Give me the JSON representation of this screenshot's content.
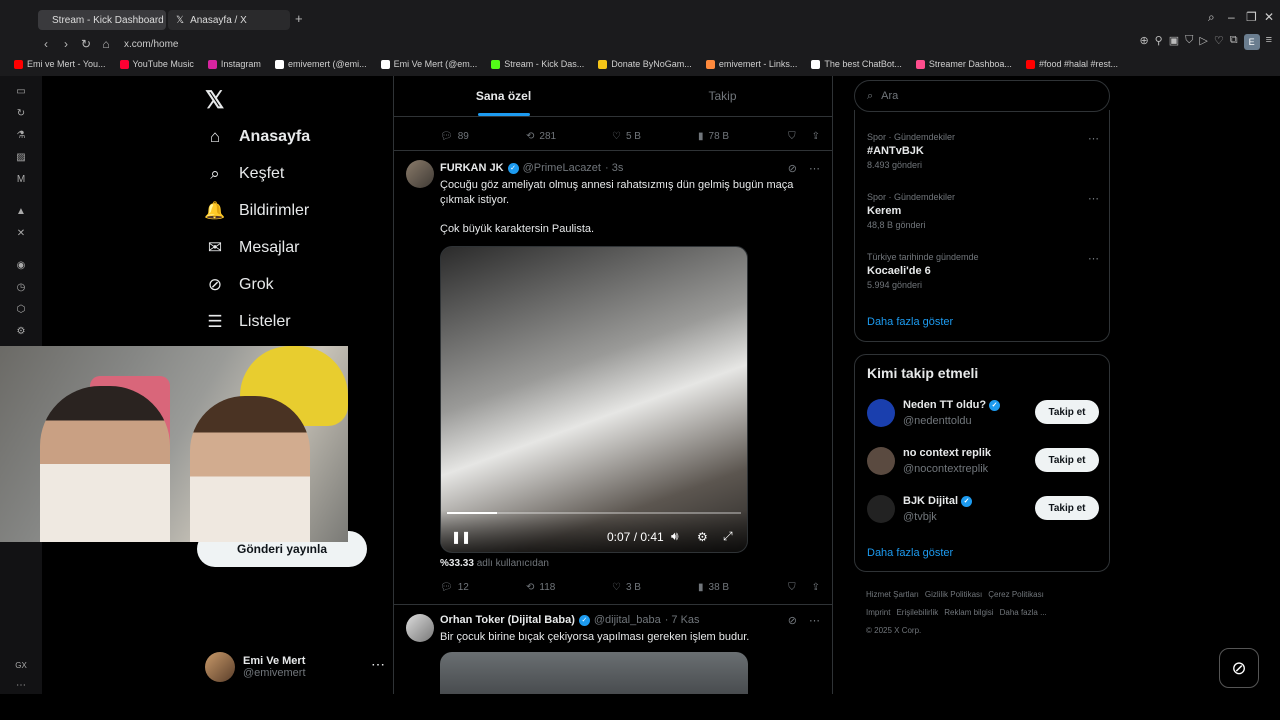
{
  "browser": {
    "tabs": [
      {
        "label": "Stream - Kick Dashboard"
      },
      {
        "label": "Anasayfa / X"
      }
    ],
    "url": "x.com/home",
    "profile_initial": "E",
    "bookmarks": [
      {
        "label": "Emi ve Mert - You...",
        "color": "#ff0000"
      },
      {
        "label": "YouTube Music",
        "color": "#ff0033"
      },
      {
        "label": "Instagram",
        "color": "#d6249f"
      },
      {
        "label": "emivemert (@emi...",
        "color": "#ffffff"
      },
      {
        "label": "Emi Ve Mert (@em...",
        "color": "#ffffff"
      },
      {
        "label": "Stream - Kick Das...",
        "color": "#53fc18"
      },
      {
        "label": "Donate ByNoGam...",
        "color": "#f5c518"
      },
      {
        "label": "emivemert - Links...",
        "color": "#ff8a3d"
      },
      {
        "label": "The best ChatBot...",
        "color": "#ffffff"
      },
      {
        "label": "Streamer Dashboa...",
        "color": "#ff4d8d"
      },
      {
        "label": "#food #halal #rest...",
        "color": "#ff0000"
      }
    ]
  },
  "nav": {
    "items": [
      {
        "label": "Anasayfa",
        "icon": "home-icon",
        "glyph": "⌂"
      },
      {
        "label": "Keşfet",
        "icon": "search-icon",
        "glyph": "⌕"
      },
      {
        "label": "Bildirimler",
        "icon": "bell-icon",
        "glyph": "🔔"
      },
      {
        "label": "Mesajlar",
        "icon": "mail-icon",
        "glyph": "✉"
      },
      {
        "label": "Grok",
        "icon": "grok-icon",
        "glyph": "⊘"
      },
      {
        "label": "Listeler",
        "icon": "list-icon",
        "glyph": "☰"
      }
    ],
    "post_button": "Gönderi yayınla",
    "profile": {
      "name": "Emi Ve Mert",
      "handle": "@emivemert"
    }
  },
  "timeline": {
    "tabs": [
      {
        "label": "Sana özel"
      },
      {
        "label": "Takip"
      }
    ],
    "prev_tweet_stats": {
      "replies": "89",
      "reposts": "281",
      "likes": "5 B",
      "views": "78 B"
    },
    "tweet1": {
      "name": "FURKAN JK",
      "handle": "@PrimeLacazet",
      "time": "· 3s",
      "text1": "Çocuğu göz ameliyatı olmuş annesi rahatsızmış dün gelmiş bugün maça çıkmak istiyor.",
      "text2": "Çok büyük karaktersin Paulista.",
      "video_time": "0:07 / 0:41",
      "video_progress": 0.17,
      "percent": "%33.33",
      "percent_suffix": "adlı kullanıcıdan",
      "stats": {
        "replies": "12",
        "reposts": "118",
        "likes": "3 B",
        "views": "38 B"
      }
    },
    "tweet2": {
      "name": "Orhan Toker (Dijital Baba)",
      "handle": "@dijital_baba",
      "time": "· 7 Kas",
      "text": "Bir çocuk birine bıçak çekiyorsa yapılması gereken işlem budur."
    }
  },
  "right": {
    "search_placeholder": "Ara",
    "trends": [
      {
        "category": "Spor · Gündemdekiler",
        "name": "#ANTvBJK",
        "count": "8.493 gönderi"
      },
      {
        "category": "Spor · Gündemdekiler",
        "name": "Kerem",
        "count": "48,8 B gönderi"
      },
      {
        "category": "Türkiye tarihinde gündemde",
        "name": "Kocaeli'de 6",
        "count": "5.994 gönderi"
      }
    ],
    "show_more": "Daha fazla göster",
    "who_title": "Kimi takip etmeli",
    "who": [
      {
        "name": "Neden TT oldu?",
        "handle": "@nedenttoldu",
        "verified": true,
        "color": "#1a3fae"
      },
      {
        "name": "no context replik",
        "handle": "@nocontextreplik",
        "verified": false,
        "color": "#5a4a40"
      },
      {
        "name": "BJK Dijital",
        "handle": "@tvbjk",
        "verified": true,
        "color": "#222222"
      }
    ],
    "follow_label": "Takip et",
    "footer": [
      "Hizmet Şartları",
      "Gizlilik Politikası",
      "Çerez Politikası",
      "Imprint",
      "Erişilebilirlik",
      "Reklam bilgisi",
      "Daha fazla ...",
      "© 2025 X Corp."
    ]
  },
  "colors": {
    "accent": "#1d9bf0",
    "bg": "#000000",
    "border": "#2f3336"
  }
}
